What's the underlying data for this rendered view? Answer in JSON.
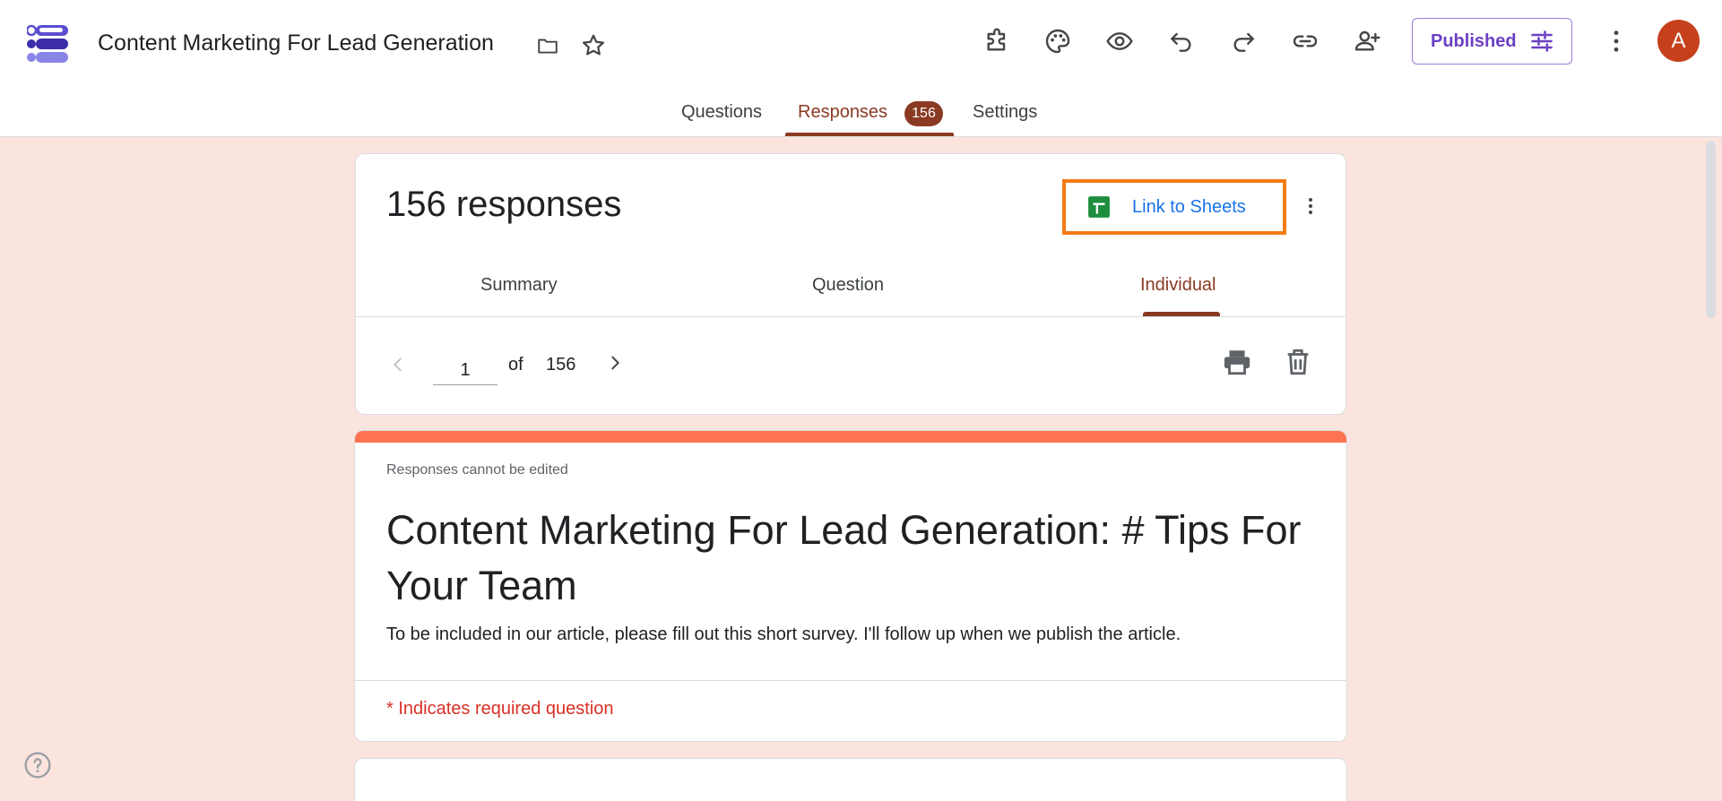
{
  "header": {
    "title": "Content Marketing For Lead Generation",
    "publish_label": "Published",
    "avatar_letter": "A"
  },
  "nav": {
    "tabs": [
      {
        "label": "Questions"
      },
      {
        "label": "Responses",
        "badge": "156"
      },
      {
        "label": "Settings"
      }
    ]
  },
  "responses": {
    "count_label": "156 responses",
    "link_sheets_label": "Link to Sheets",
    "sub_tabs": [
      {
        "label": "Summary"
      },
      {
        "label": "Question"
      },
      {
        "label": "Individual"
      }
    ],
    "pager": {
      "current": "1",
      "of_label": "of",
      "total": "156"
    }
  },
  "form": {
    "not_edited": "Responses cannot be edited",
    "title": "Content Marketing For Lead Generation: # Tips For Your Team",
    "description": "To be included in our article, please fill out this short survey. I'll follow up when we publish the article.",
    "required_note": "* Indicates required question"
  },
  "colors": {
    "accent": "#8a3a23",
    "background": "#fce4de",
    "highlight_box": "#f27b14",
    "form_accent": "#ff7351",
    "published": "#6c3fc4"
  }
}
